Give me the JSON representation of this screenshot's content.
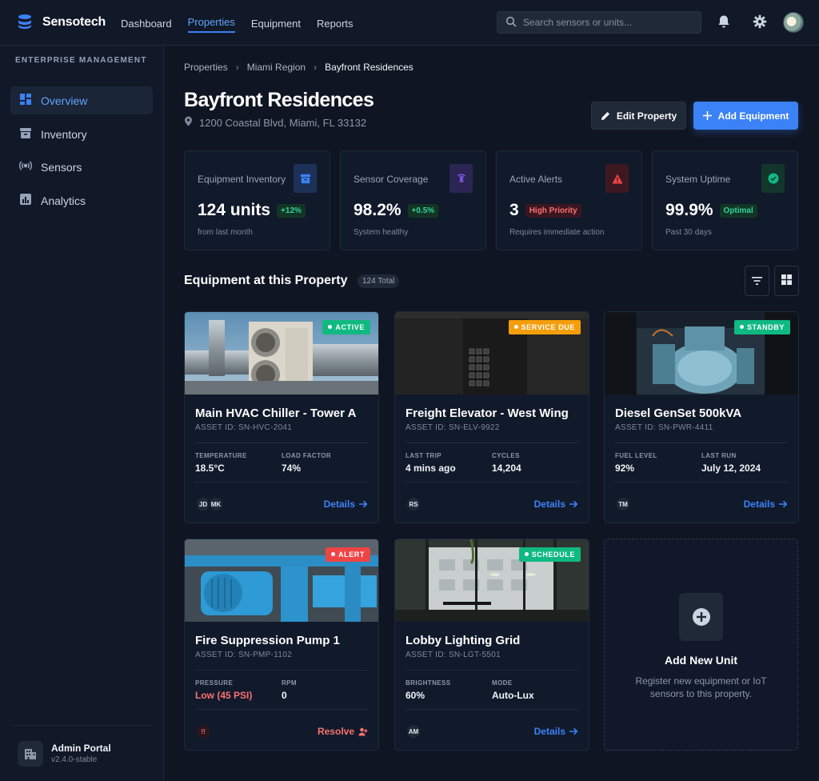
{
  "brand": {
    "name": "Sensotech"
  },
  "nav": {
    "items": [
      "Dashboard",
      "Properties",
      "Equipment",
      "Reports"
    ],
    "active": "Properties"
  },
  "search": {
    "placeholder": "Search sensors or units..."
  },
  "sidebar": {
    "section": "ENTERPRISE MANAGEMENT",
    "items": [
      {
        "label": "Overview",
        "icon": "dashboard-icon",
        "active": true
      },
      {
        "label": "Inventory",
        "icon": "archive-icon"
      },
      {
        "label": "Sensors",
        "icon": "sensor-icon"
      },
      {
        "label": "Analytics",
        "icon": "chart-icon"
      }
    ],
    "footer": {
      "title": "Admin Portal",
      "version": "v2.4.0-stable"
    }
  },
  "breadcrumb": [
    "Properties",
    "Miami Region",
    "Bayfront Residences"
  ],
  "property": {
    "name": "Bayfront Residences",
    "address": "1200 Coastal Blvd, Miami, FL 33132"
  },
  "actions": {
    "edit": "Edit Property",
    "add": "Add Equipment"
  },
  "stats": [
    {
      "label": "Equipment Inventory",
      "value": "124 units",
      "chip": "+12%",
      "sub": "from last month",
      "color": "#3b82f6",
      "icon": "archive-icon"
    },
    {
      "label": "Sensor Coverage",
      "value": "98.2%",
      "chip": "+0.5%",
      "sub": "System healthy",
      "color": "#8b5cf6",
      "icon": "wifi-icon"
    },
    {
      "label": "Active Alerts",
      "value": "3",
      "chip": "High Priority",
      "sub": "Requires immediate action",
      "color": "#ef4444",
      "icon": "warning-icon"
    },
    {
      "label": "System Uptime",
      "value": "99.9%",
      "chip": "Optimal",
      "sub": "Past 30 days",
      "color": "#10b981",
      "icon": "check-circle-icon"
    }
  ],
  "equipment_section": {
    "title": "Equipment at this Property",
    "count": "124 Total"
  },
  "equipment": [
    {
      "title": "Main HVAC Chiller - Tower A",
      "asset": "ASSET ID: SN-HVC-2041",
      "status": "ACTIVE",
      "m1_label": "TEMPERATURE",
      "m1_value": "18.5°C",
      "m2_label": "LOAD FACTOR",
      "m2_value": "74%",
      "avatars": [
        "JD",
        "MK"
      ],
      "link": "Details"
    },
    {
      "title": "Freight Elevator - West Wing",
      "asset": "ASSET ID: SN-ELV-9922",
      "status": "SERVICE DUE",
      "m1_label": "LAST TRIP",
      "m1_value": "4 mins ago",
      "m2_label": "CYCLES",
      "m2_value": "14,204",
      "avatars": [
        "RS"
      ],
      "link": "Details"
    },
    {
      "title": "Diesel GenSet 500kVA",
      "asset": "ASSET ID: SN-PWR-4411",
      "status": "STANDBY",
      "m1_label": "FUEL LEVEL",
      "m1_value": "92%",
      "m2_label": "LAST RUN",
      "m2_value": "July 12, 2024",
      "avatars": [
        "TM"
      ],
      "link": "Details"
    },
    {
      "title": "Fire Suppression Pump 1",
      "asset": "ASSET ID: SN-PMP-1102",
      "status": "ALERT",
      "m1_label": "PRESSURE",
      "m1_value": "Low (45 PSI)",
      "m2_label": "RPM",
      "m2_value": "0",
      "avatars": [
        "!!"
      ],
      "link": "Resolve"
    },
    {
      "title": "Lobby Lighting Grid",
      "asset": "ASSET ID: SN-LGT-5501",
      "status": "SCHEDULE",
      "m1_label": "BRIGHTNESS",
      "m1_value": "60%",
      "m2_label": "MODE",
      "m2_value": "Auto-Lux",
      "avatars": [
        "AM"
      ],
      "link": "Details"
    }
  ],
  "add_unit": {
    "title": "Add New Unit",
    "subtitle": "Register new equipment or IoT sensors to this property."
  }
}
